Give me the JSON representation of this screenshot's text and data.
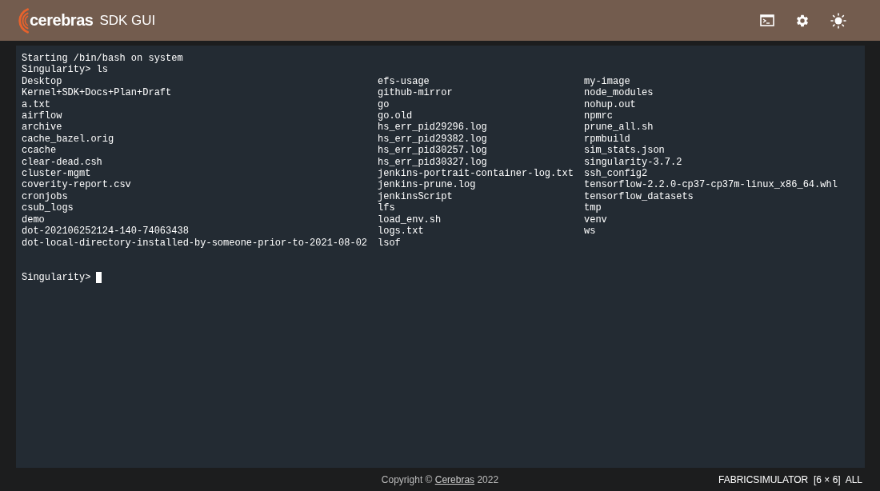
{
  "header": {
    "logo_text": "cerebras",
    "title": "SDK GUI"
  },
  "terminal": {
    "lines": [
      "Starting /bin/bash on system",
      "Singularity> ls"
    ],
    "listing": [
      [
        "Desktop",
        "Kernel+SDK+Docs+Plan+Draft",
        "a.txt",
        "airflow",
        "archive",
        "cache_bazel.orig",
        "ccache",
        "clear-dead.csh",
        "cluster-mgmt",
        "coverity-report.csv",
        "cronjobs",
        "csub_logs",
        "demo",
        "dot-202106252124-140-74063438",
        "dot-local-directory-installed-by-someone-prior-to-2021-08-02"
      ],
      [
        "efs-usage",
        "github-mirror",
        "go",
        "go.old",
        "hs_err_pid29296.log",
        "hs_err_pid29382.log",
        "hs_err_pid30257.log",
        "hs_err_pid30327.log",
        "jenkins-portrait-container-log.txt",
        "jenkins-prune.log",
        "jenkinsScript",
        "lfs",
        "load_env.sh",
        "logs.txt",
        "lsof"
      ],
      [
        "my-image",
        "node_modules",
        "nohup.out",
        "npmrc",
        "prune_all.sh",
        "rpmbuild",
        "sim_stats.json",
        "singularity-3.7.2",
        "ssh_config2",
        "tensorflow-2.2.0-cp37-cp37m-linux_x86_64.whl",
        "tensorflow_datasets",
        "tmp",
        "venv",
        "ws"
      ]
    ],
    "prompt": "Singularity>"
  },
  "footer": {
    "copyright_before": "Copyright ©",
    "copyright_link": "Cerebras",
    "copyright_after": "2022",
    "status": "FABRICSIMULATOR  [6 × 6]  ALL"
  }
}
